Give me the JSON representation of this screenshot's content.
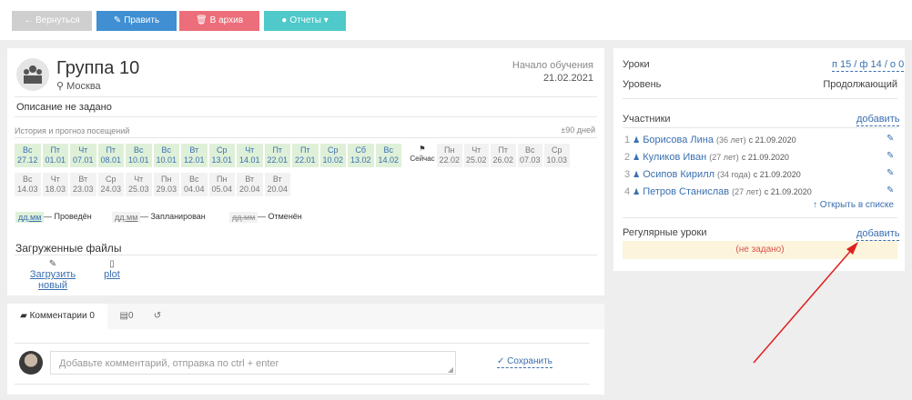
{
  "toolbar": {
    "back": "← Вернуться",
    "edit": "Править",
    "archive": "В архив",
    "reports": "Отчеты"
  },
  "group": {
    "title": "Группа 10",
    "city": "Москва",
    "start_label": "Начало обучения",
    "start_date": "21.02.2021",
    "description": "Описание не задано"
  },
  "attendance": {
    "heading": "История и прогноз посещений",
    "range": "±90 дней",
    "now_label": "Сейчас",
    "row1_past": [
      {
        "d": "Вс",
        "date": "27.12"
      },
      {
        "d": "Пт",
        "date": "01.01"
      },
      {
        "d": "Чт",
        "date": "07.01"
      },
      {
        "d": "Пт",
        "date": "08.01"
      },
      {
        "d": "Вс",
        "date": "10.01"
      },
      {
        "d": "Вс",
        "date": "10.01"
      },
      {
        "d": "Вт",
        "date": "12.01"
      },
      {
        "d": "Ср",
        "date": "13.01"
      },
      {
        "d": "Чт",
        "date": "14.01"
      },
      {
        "d": "Пт",
        "date": "22.01"
      },
      {
        "d": "Пт",
        "date": "22.01"
      },
      {
        "d": "Ср",
        "date": "10.02"
      },
      {
        "d": "Сб",
        "date": "13.02"
      },
      {
        "d": "Вс",
        "date": "14.02"
      }
    ],
    "row1_plan": [
      {
        "d": "Пн",
        "date": "22.02"
      },
      {
        "d": "Чт",
        "date": "25.02"
      },
      {
        "d": "Пт",
        "date": "26.02"
      },
      {
        "d": "Вс",
        "date": "07.03"
      },
      {
        "d": "Ср",
        "date": "10.03"
      }
    ],
    "row2_plan": [
      {
        "d": "Вс",
        "date": "14.03"
      },
      {
        "d": "Чт",
        "date": "18.03"
      },
      {
        "d": "Вт",
        "date": "23.03"
      },
      {
        "d": "Ср",
        "date": "24.03"
      },
      {
        "d": "Чт",
        "date": "25.03"
      },
      {
        "d": "Пн",
        "date": "29.03"
      },
      {
        "d": "Вс",
        "date": "04.04"
      },
      {
        "d": "Пн",
        "date": "05.04"
      },
      {
        "d": "Вт",
        "date": "20.04"
      },
      {
        "d": "Вт",
        "date": "20.04"
      }
    ],
    "legend": {
      "chip": "дд.мм",
      "held": "— Проведён",
      "planned": "— Запланирован",
      "cancelled": "— Отменён"
    }
  },
  "files": {
    "heading": "Загруженные файлы",
    "upload": "Загрузить новый",
    "file_name": "plot"
  },
  "tabs": {
    "comments": "Комментарии 0",
    "files_count": "0"
  },
  "comment": {
    "placeholder": "Добавьте комментарий, отправка по ctrl + enter",
    "save": "Сохранить"
  },
  "sidebar": {
    "lessons_label": "Уроки",
    "lessons_value": "п 15 / ф 14 / о 0",
    "level_label": "Уровень",
    "level_value": "Продолжающий",
    "participants_label": "Участники",
    "add": "добавить",
    "members": [
      {
        "n": "1",
        "name": "Борисова Лина",
        "age": "(36 лет)",
        "since": "с 21.09.2020"
      },
      {
        "n": "2",
        "name": "Куликов Иван",
        "age": "(27 лет)",
        "since": "с 21.09.2020"
      },
      {
        "n": "3",
        "name": "Осипов Кирилл",
        "age": "(34 года)",
        "since": "с 21.09.2020"
      },
      {
        "n": "4",
        "name": "Петров Станислав",
        "age": "(27 лет)",
        "since": "с 21.09.2020"
      }
    ],
    "open_list": "Открыть в списке",
    "regular_label": "Регулярные уроки",
    "regular_add": "добавить",
    "regular_empty": "(не задано)"
  },
  "colors": {
    "back_btn": "#cfcfcf",
    "edit_btn": "#3f8fd2",
    "archive_btn": "#ec6e7a",
    "reports_btn": "#4fc9c9",
    "annotation_arrow": "#e02020"
  }
}
